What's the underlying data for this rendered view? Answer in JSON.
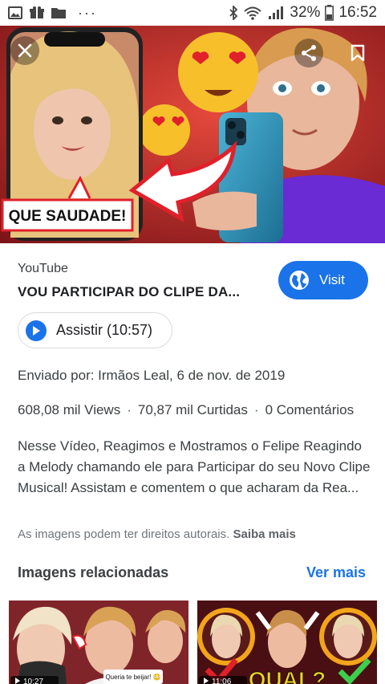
{
  "status_bar": {
    "battery": "32%",
    "time": "16:52",
    "more": "···",
    "icons": [
      "image-icon",
      "gift-icon",
      "folder-icon",
      "bluetooth-icon",
      "wifi-icon",
      "signal-icon",
      "battery-icon"
    ]
  },
  "hero": {
    "caption": "QUE SAUDADE!",
    "buttons": [
      "close-icon",
      "share-icon",
      "bookmark-icon"
    ]
  },
  "result": {
    "source": "YouTube",
    "title": "VOU PARTICIPAR DO CLIPE DA...",
    "visit_label": "Visit",
    "watch_label": "Assistir (10:57)",
    "uploaded": "Enviado por: Irmãos Leal, 6 de nov. de 2019",
    "views": "608,08 mil Views",
    "likes": "70,87 mil Curtidas",
    "comments": "0 Comentários",
    "separator": "·",
    "description": "Nesse Vídeo, Reagimos e Mostramos o Felipe Reagindo a Melody chamando ele para Participar do seu Novo Clipe Musical! Assistam e comentem o que acharam da Rea...",
    "copyright_text": "As imagens podem ter direitos autorais.",
    "copyright_link": "Saiba mais"
  },
  "related": {
    "title": "Imagens relacionadas",
    "see_more": "Ver mais",
    "items": [
      {
        "duration": "10:27",
        "bubble": "Queria te beijar! 😳"
      },
      {
        "duration": "11:06",
        "overlay": "QUAL?"
      }
    ]
  },
  "colors": {
    "accent": "#1a73e8",
    "text": "#202124",
    "muted": "#3c4043",
    "hero_bg": "#b5232a",
    "shirt": "#6a2bd4"
  }
}
